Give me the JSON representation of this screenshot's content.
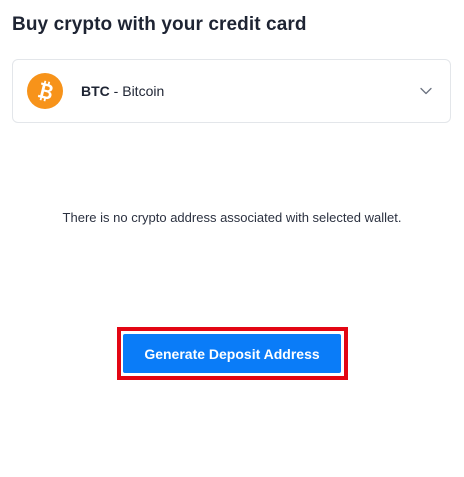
{
  "page": {
    "title": "Buy crypto with your credit card"
  },
  "asset_select": {
    "ticker": "BTC",
    "separator": " - ",
    "name": "Bitcoin",
    "icon": "bitcoin-icon",
    "icon_color": "#f7931a",
    "dropdown_icon": "chevron-down-icon"
  },
  "message": {
    "text": "There is no crypto address associated with selected wallet."
  },
  "actions": {
    "generate_label": "Generate Deposit Address",
    "button_color": "#0a7cf8",
    "highlight_color": "#e30613"
  }
}
